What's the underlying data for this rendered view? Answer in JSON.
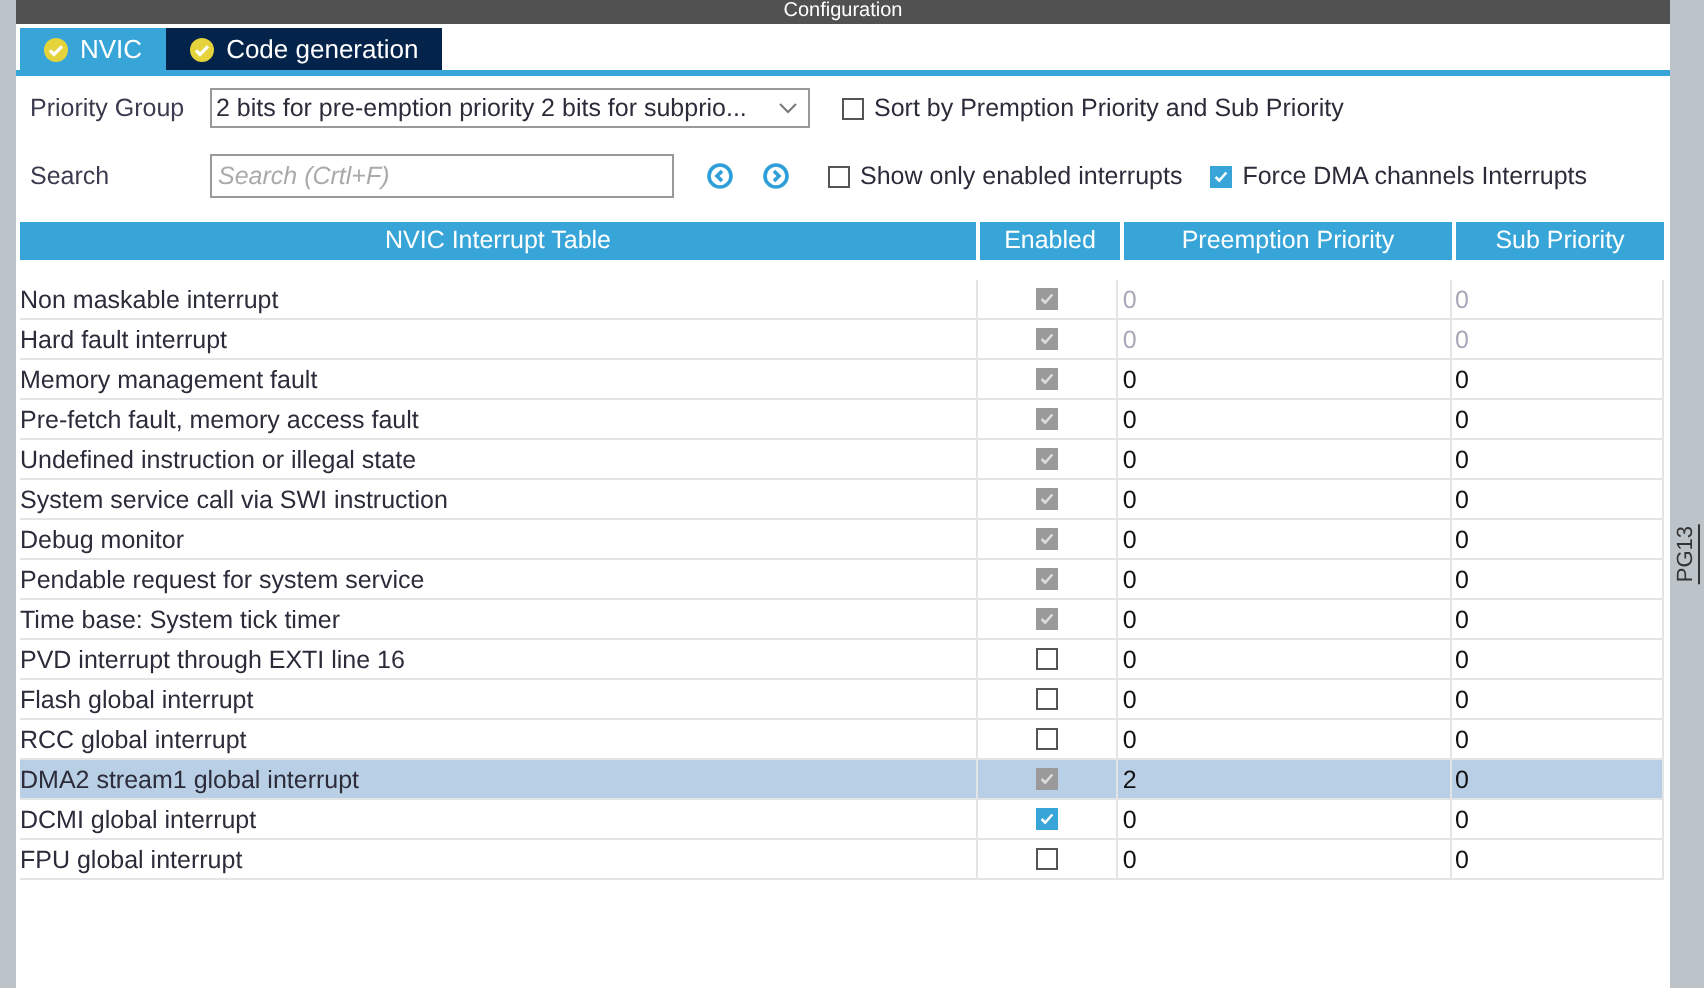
{
  "window": {
    "title": "Configuration"
  },
  "tabs": [
    {
      "label": "NVIC",
      "selected": true
    },
    {
      "label": "Code generation",
      "selected": false
    }
  ],
  "priority_group": {
    "label": "Priority Group",
    "value": "2 bits for pre-emption priority 2 bits for subprio..."
  },
  "search": {
    "label": "Search",
    "placeholder": "Search (Crtl+F)"
  },
  "options": [
    {
      "label": "Sort by Premption Priority and Sub Priority",
      "checked": false
    },
    {
      "label": "Show only enabled interrupts",
      "checked": false
    },
    {
      "label": "Force DMA channels Interrupts",
      "checked": true
    }
  ],
  "table": {
    "columns": [
      "NVIC Interrupt Table",
      "Enabled",
      "Preemption Priority",
      "Sub Priority"
    ],
    "rows": [
      {
        "name": "Non maskable interrupt",
        "enabled": true,
        "locked": true,
        "priorities_disabled": true,
        "preemption": "0",
        "sub": "0",
        "selected": false
      },
      {
        "name": "Hard fault interrupt",
        "enabled": true,
        "locked": true,
        "priorities_disabled": true,
        "preemption": "0",
        "sub": "0",
        "selected": false
      },
      {
        "name": "Memory management fault",
        "enabled": true,
        "locked": true,
        "priorities_disabled": false,
        "preemption": "0",
        "sub": "0",
        "selected": false
      },
      {
        "name": "Pre-fetch fault, memory access fault",
        "enabled": true,
        "locked": true,
        "priorities_disabled": false,
        "preemption": "0",
        "sub": "0",
        "selected": false
      },
      {
        "name": "Undefined instruction or illegal state",
        "enabled": true,
        "locked": true,
        "priorities_disabled": false,
        "preemption": "0",
        "sub": "0",
        "selected": false
      },
      {
        "name": "System service call via SWI instruction",
        "enabled": true,
        "locked": true,
        "priorities_disabled": false,
        "preemption": "0",
        "sub": "0",
        "selected": false
      },
      {
        "name": "Debug monitor",
        "enabled": true,
        "locked": true,
        "priorities_disabled": false,
        "preemption": "0",
        "sub": "0",
        "selected": false
      },
      {
        "name": "Pendable request for system service",
        "enabled": true,
        "locked": true,
        "priorities_disabled": false,
        "preemption": "0",
        "sub": "0",
        "selected": false
      },
      {
        "name": "Time base: System tick timer",
        "enabled": true,
        "locked": true,
        "priorities_disabled": false,
        "preemption": "0",
        "sub": "0",
        "selected": false
      },
      {
        "name": "PVD interrupt through EXTI line 16",
        "enabled": false,
        "locked": false,
        "priorities_disabled": false,
        "preemption": "0",
        "sub": "0",
        "selected": false
      },
      {
        "name": "Flash global interrupt",
        "enabled": false,
        "locked": false,
        "priorities_disabled": false,
        "preemption": "0",
        "sub": "0",
        "selected": false
      },
      {
        "name": "RCC global interrupt",
        "enabled": false,
        "locked": false,
        "priorities_disabled": false,
        "preemption": "0",
        "sub": "0",
        "selected": false
      },
      {
        "name": "DMA2 stream1 global interrupt",
        "enabled": true,
        "locked": true,
        "priorities_disabled": false,
        "preemption": "2",
        "sub": "0",
        "selected": true
      },
      {
        "name": "DCMI global interrupt",
        "enabled": true,
        "locked": false,
        "priorities_disabled": false,
        "preemption": "0",
        "sub": "0",
        "selected": false
      },
      {
        "name": "FPU global interrupt",
        "enabled": false,
        "locked": false,
        "priorities_disabled": false,
        "preemption": "0",
        "sub": "0",
        "selected": false
      }
    ]
  },
  "side_label": "PG13"
}
